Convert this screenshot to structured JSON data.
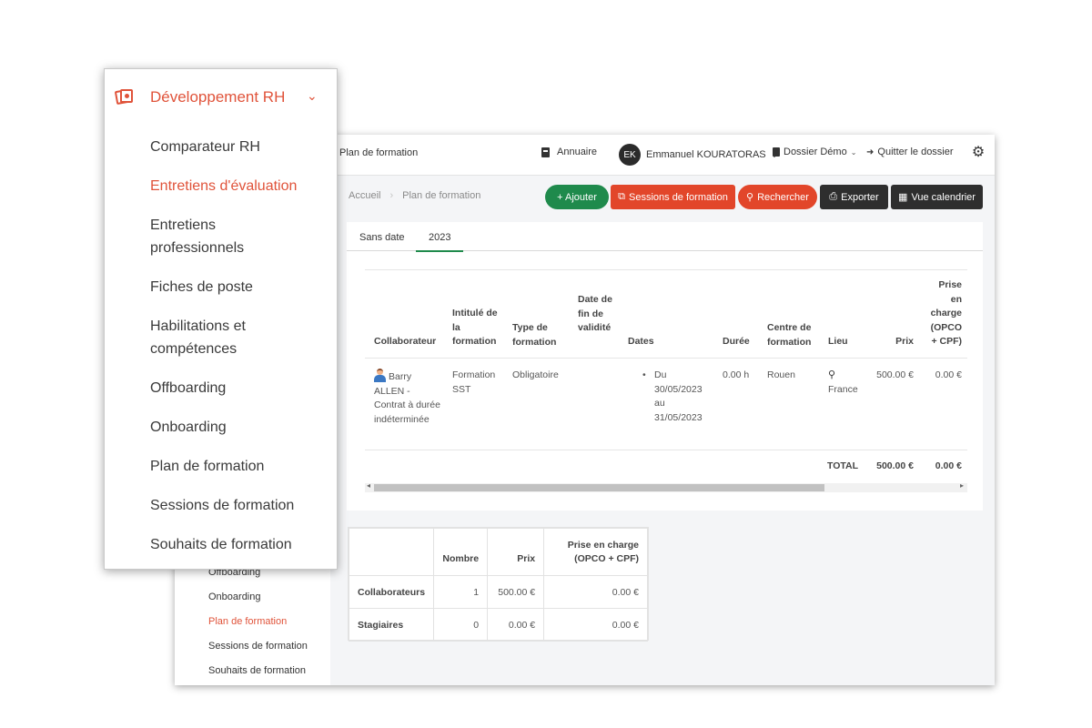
{
  "menu": {
    "title": "Développement RH",
    "items": [
      "Comparateur RH",
      "Entretiens d'évaluation",
      "Entretiens professionnels",
      "Fiches de poste",
      "Habilitations et compétences",
      "Offboarding",
      "Onboarding",
      "Plan de formation",
      "Sessions de formation",
      "Souhaits de formation"
    ],
    "active_item": "Entretiens d'évaluation",
    "accent_color": "#e0533a"
  },
  "bg_sidebar": {
    "items": [
      "Offboarding",
      "Onboarding",
      "Plan de formation",
      "Sessions de formation",
      "Souhaits de formation"
    ],
    "active_item": "Plan de formation"
  },
  "topbar": {
    "page_title": "Plan de formation",
    "annuaire": "Annuaire",
    "user_initials": "EK",
    "user_name": "Emmanuel KOURATORAS",
    "dossier": "Dossier Démo",
    "quit": "Quitter le dossier"
  },
  "breadcrumb": {
    "home": "Accueil",
    "current": "Plan de formation"
  },
  "actions": {
    "add": "+ Ajouter",
    "sessions": "Sessions de formation",
    "search": "Rechercher",
    "export": "Exporter",
    "calendar": "Vue calendrier"
  },
  "tabs": [
    "Sans date",
    "2023"
  ],
  "active_tab": "2023",
  "table": {
    "headers": {
      "collaborateur": "Collaborateur",
      "intitule": "Intitulé de la formation",
      "type": "Type de formation",
      "date_fin": "Date de fin de validité",
      "dates": "Dates",
      "duree": "Durée",
      "centre": "Centre de formation",
      "lieu": "Lieu",
      "prix": "Prix",
      "prise": "Prise en charge (OPCO + CPF)"
    },
    "row": {
      "collaborateur": "Barry ALLEN - Contrat à durée indéterminée",
      "intitule": "Formation SST",
      "type": "Obligatoire",
      "date_fin": "",
      "dates": "Du 30/05/2023 au 31/05/2023",
      "duree": "0.00 h",
      "centre": "Rouen",
      "lieu": "France",
      "prix": "500.00 €",
      "prise": "0.00 €"
    },
    "total_label": "TOTAL",
    "total_prix": "500.00 €",
    "total_prise": "0.00 €"
  },
  "summary": {
    "headers": [
      "",
      "Nombre",
      "Prix",
      "Prise en charge (OPCO + CPF)"
    ],
    "rows": [
      {
        "label": "Collaborateurs",
        "nombre": "1",
        "prix": "500.00 €",
        "prise": "0.00 €"
      },
      {
        "label": "Stagiaires",
        "nombre": "0",
        "prix": "0.00 €",
        "prise": "0.00 €"
      }
    ]
  },
  "colors": {
    "green": "#1f8a4c",
    "red": "#e2462a",
    "dark": "#2e2e2e"
  }
}
